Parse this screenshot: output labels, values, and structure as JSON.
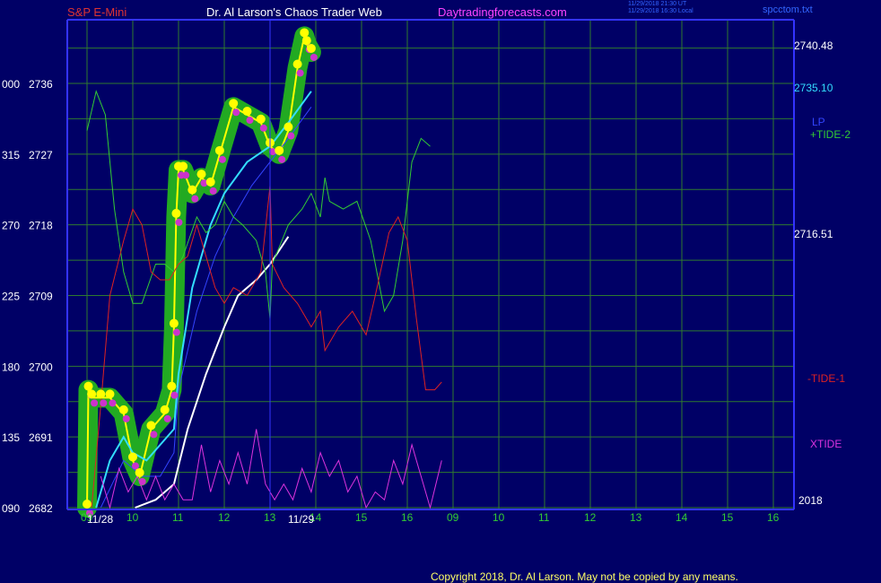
{
  "header": {
    "symbol": "S&P E-Mini",
    "title": "Dr. Al Larson's Chaos Trader Web",
    "site": "Daytradingforecasts.com",
    "timestamp_utc": "11/29/2018 21:30 UT",
    "timestamp_local": "11/29/2018 16:30 Local",
    "file": "spcctom.txt"
  },
  "footer": {
    "copyright": "Copyright 2018, Dr. Al Larson. May not be copied by any means."
  },
  "colors": {
    "background": "#000066",
    "grid": "#2f7a2f",
    "price": "#ffff00",
    "tide1": "#dd2222",
    "tide2": "#33cc33",
    "xtide": "#dd33dd",
    "cyan_ma": "#33ddff",
    "blue_ma": "#3344ff",
    "white_line": "#ffffff",
    "axis": "#3333ff"
  },
  "chart_data": {
    "type": "line",
    "title": "S&P E-Mini",
    "ylim": [
      2682,
      2745
    ],
    "left_axis_ticks": [
      {
        "osc": "000",
        "price": 2736
      },
      {
        "osc": "315",
        "price": 2727
      },
      {
        "osc": "270",
        "price": 2718
      },
      {
        "osc": "225",
        "price": 2709
      },
      {
        "osc": "180",
        "price": 2700
      },
      {
        "osc": "135",
        "price": 2691
      },
      {
        "osc": "090",
        "price": 2682
      }
    ],
    "x_hour_labels": [
      "09",
      "10",
      "11",
      "12",
      "13",
      "14",
      "15",
      "16",
      "09",
      "10",
      "11",
      "12",
      "13",
      "14",
      "15",
      "16"
    ],
    "date_labels": [
      "11/28",
      "11/29"
    ],
    "right_labels": [
      {
        "text": "2740.48",
        "price": 2740.48,
        "color": "#ffffff"
      },
      {
        "text": "2735.10",
        "price": 2735.1,
        "color": "#33ddff"
      },
      {
        "text": "LP",
        "color": "#3344ff"
      },
      {
        "text": "+TIDE-2",
        "color": "#33cc33"
      },
      {
        "text": "2716.51",
        "price": 2716.51,
        "color": "#ffffff"
      },
      {
        "text": "-TIDE-1",
        "color": "#dd2222"
      },
      {
        "text": "XTIDE",
        "color": "#dd33dd"
      },
      {
        "text": "2018",
        "color": "#ffffff"
      }
    ],
    "series": [
      {
        "key": "price",
        "values": [
          [
            0,
            2682
          ],
          [
            0.03,
            2697
          ],
          [
            0.1,
            2696
          ],
          [
            0.3,
            2696
          ],
          [
            0.5,
            2696
          ],
          [
            0.8,
            2694
          ],
          [
            1.0,
            2688
          ],
          [
            1.15,
            2686
          ],
          [
            1.4,
            2692
          ],
          [
            1.7,
            2694
          ],
          [
            1.85,
            2697
          ],
          [
            1.9,
            2705
          ],
          [
            1.95,
            2719
          ],
          [
            2.0,
            2725
          ],
          [
            2.1,
            2725
          ],
          [
            2.3,
            2722
          ],
          [
            2.5,
            2724
          ],
          [
            2.7,
            2723
          ],
          [
            2.9,
            2727
          ],
          [
            3.2,
            2733
          ],
          [
            3.5,
            2732
          ],
          [
            3.8,
            2731
          ],
          [
            4.0,
            2728
          ],
          [
            4.2,
            2727
          ],
          [
            4.4,
            2730
          ],
          [
            4.6,
            2738
          ],
          [
            4.75,
            2742
          ],
          [
            4.8,
            2741
          ],
          [
            4.9,
            2740
          ]
        ]
      },
      {
        "key": "cyan_ma",
        "values": [
          [
            0.2,
            2682
          ],
          [
            0.5,
            2688
          ],
          [
            0.8,
            2691
          ],
          [
            1.0,
            2689
          ],
          [
            1.3,
            2688
          ],
          [
            1.6,
            2690
          ],
          [
            1.9,
            2692
          ],
          [
            2.0,
            2699
          ],
          [
            2.3,
            2710
          ],
          [
            2.7,
            2718
          ],
          [
            3.0,
            2722
          ],
          [
            3.5,
            2726
          ],
          [
            4.0,
            2728
          ],
          [
            4.4,
            2731
          ],
          [
            4.9,
            2735
          ]
        ]
      },
      {
        "key": "blue_ma",
        "values": [
          [
            0.3,
            2682
          ],
          [
            0.8,
            2688
          ],
          [
            1.2,
            2686
          ],
          [
            1.6,
            2686
          ],
          [
            1.9,
            2689
          ],
          [
            2.0,
            2697
          ],
          [
            2.4,
            2707
          ],
          [
            2.8,
            2714
          ],
          [
            3.2,
            2719
          ],
          [
            3.6,
            2723
          ],
          [
            4.0,
            2726
          ],
          [
            4.4,
            2729
          ],
          [
            4.9,
            2733
          ]
        ]
      },
      {
        "key": "white_line",
        "values": [
          [
            1.05,
            2682
          ],
          [
            1.5,
            2683
          ],
          [
            1.9,
            2685
          ],
          [
            2.2,
            2692
          ],
          [
            2.6,
            2699
          ],
          [
            3.0,
            2705
          ],
          [
            3.3,
            2709
          ],
          [
            3.7,
            2711
          ],
          [
            4.0,
            2713
          ],
          [
            4.4,
            2716.5
          ]
        ]
      },
      {
        "key": "tide2",
        "values": [
          [
            0,
            2730
          ],
          [
            0.2,
            2735
          ],
          [
            0.4,
            2732
          ],
          [
            0.6,
            2720
          ],
          [
            0.8,
            2712
          ],
          [
            1.0,
            2708
          ],
          [
            1.2,
            2708
          ],
          [
            1.5,
            2713
          ],
          [
            1.7,
            2713
          ],
          [
            1.9,
            2712
          ],
          [
            2.1,
            2714
          ],
          [
            2.4,
            2719
          ],
          [
            2.6,
            2717
          ],
          [
            2.8,
            2718
          ],
          [
            3.0,
            2721
          ],
          [
            3.2,
            2719
          ],
          [
            3.4,
            2718
          ],
          [
            3.7,
            2716
          ],
          [
            3.9,
            2712
          ],
          [
            4.0,
            2706
          ],
          [
            4.05,
            2713
          ],
          [
            4.4,
            2718
          ],
          [
            4.7,
            2720
          ],
          [
            4.9,
            2722
          ],
          [
            5.1,
            2719
          ],
          [
            5.2,
            2724
          ],
          [
            5.3,
            2721
          ],
          [
            5.6,
            2720
          ],
          [
            5.9,
            2721
          ],
          [
            6.2,
            2716
          ],
          [
            6.5,
            2707
          ],
          [
            6.7,
            2709
          ],
          [
            6.9,
            2716
          ],
          [
            7.1,
            2726
          ],
          [
            7.3,
            2729
          ],
          [
            7.5,
            2728
          ]
        ]
      },
      {
        "key": "tide1",
        "values": [
          [
            0.1,
            2682
          ],
          [
            0.3,
            2695
          ],
          [
            0.5,
            2709
          ],
          [
            0.8,
            2716
          ],
          [
            1.0,
            2720
          ],
          [
            1.2,
            2718
          ],
          [
            1.4,
            2712
          ],
          [
            1.6,
            2711
          ],
          [
            1.8,
            2711
          ],
          [
            2.0,
            2713
          ],
          [
            2.2,
            2714
          ],
          [
            2.4,
            2718
          ],
          [
            2.6,
            2714
          ],
          [
            2.8,
            2710
          ],
          [
            3.0,
            2708
          ],
          [
            3.2,
            2710
          ],
          [
            3.5,
            2709
          ],
          [
            3.8,
            2712
          ],
          [
            4.0,
            2723
          ],
          [
            4.05,
            2713
          ],
          [
            4.3,
            2710
          ],
          [
            4.6,
            2708
          ],
          [
            4.9,
            2705
          ],
          [
            5.1,
            2707
          ],
          [
            5.2,
            2702
          ],
          [
            5.5,
            2705
          ],
          [
            5.8,
            2707
          ],
          [
            6.1,
            2704
          ],
          [
            6.3,
            2709
          ],
          [
            6.6,
            2717
          ],
          [
            6.8,
            2719
          ],
          [
            7.0,
            2716
          ],
          [
            7.2,
            2706
          ],
          [
            7.4,
            2697
          ],
          [
            7.6,
            2697
          ],
          [
            7.75,
            2698
          ]
        ]
      },
      {
        "key": "xtide",
        "values": [
          [
            0.3,
            2686
          ],
          [
            0.5,
            2682
          ],
          [
            0.7,
            2687
          ],
          [
            0.9,
            2684
          ],
          [
            1.1,
            2686
          ],
          [
            1.3,
            2683
          ],
          [
            1.5,
            2686
          ],
          [
            1.7,
            2683
          ],
          [
            1.9,
            2685
          ],
          [
            2.1,
            2683
          ],
          [
            2.3,
            2683
          ],
          [
            2.5,
            2690
          ],
          [
            2.7,
            2684
          ],
          [
            2.9,
            2688
          ],
          [
            3.1,
            2685
          ],
          [
            3.3,
            2689
          ],
          [
            3.5,
            2685
          ],
          [
            3.7,
            2692
          ],
          [
            3.9,
            2685
          ],
          [
            4.1,
            2683
          ],
          [
            4.3,
            2685
          ],
          [
            4.5,
            2683
          ],
          [
            4.7,
            2687
          ],
          [
            4.9,
            2684
          ],
          [
            5.1,
            2689
          ],
          [
            5.3,
            2686
          ],
          [
            5.5,
            2688
          ],
          [
            5.7,
            2684
          ],
          [
            5.9,
            2686
          ],
          [
            6.1,
            2682
          ],
          [
            6.3,
            2684
          ],
          [
            6.5,
            2683
          ],
          [
            6.7,
            2688
          ],
          [
            6.9,
            2685
          ],
          [
            7.1,
            2690
          ],
          [
            7.3,
            2686
          ],
          [
            7.5,
            2682
          ],
          [
            7.75,
            2688
          ]
        ]
      }
    ]
  }
}
